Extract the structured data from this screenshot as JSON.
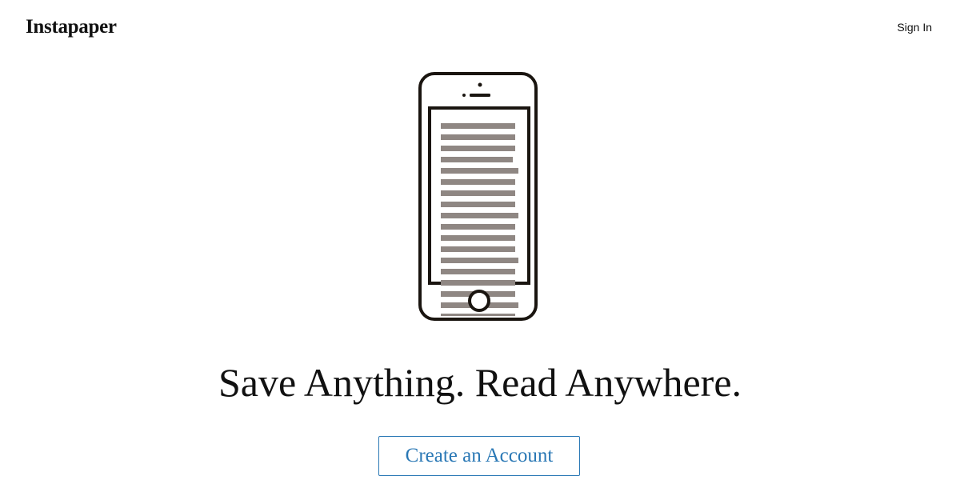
{
  "header": {
    "logo": "Instapaper",
    "sign_in_label": "Sign In"
  },
  "hero": {
    "illustration_icon": "phone-reading-icon",
    "headline": "Save Anything. Read Anywhere.",
    "cta_label": "Create an Account"
  },
  "colors": {
    "text": "#111111",
    "accent": "#2a78b5",
    "phone_outline": "#1a1510",
    "text_lines": "#8f8783",
    "background": "#ffffff"
  }
}
